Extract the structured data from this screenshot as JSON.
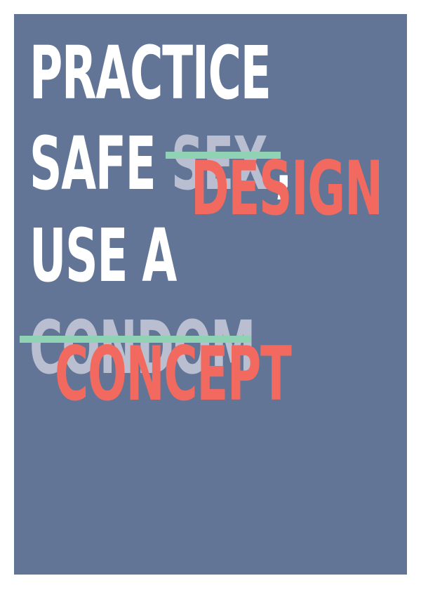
{
  "poster": {
    "line1": "PRACTICE",
    "line2_word": "SAFE",
    "struck_word_1": "SEX",
    "comma": ",",
    "replacement_1": "DESIGN",
    "line3": "USE A",
    "struck_word_2": "CONDOM",
    "replacement_2": "CONCEPT"
  },
  "colors": {
    "background": "#627596",
    "primary_text": "#ffffff",
    "struck_text": "#b9bfd0",
    "replacement_text": "#f26a5f",
    "strike_line": "#8fd3b4"
  }
}
